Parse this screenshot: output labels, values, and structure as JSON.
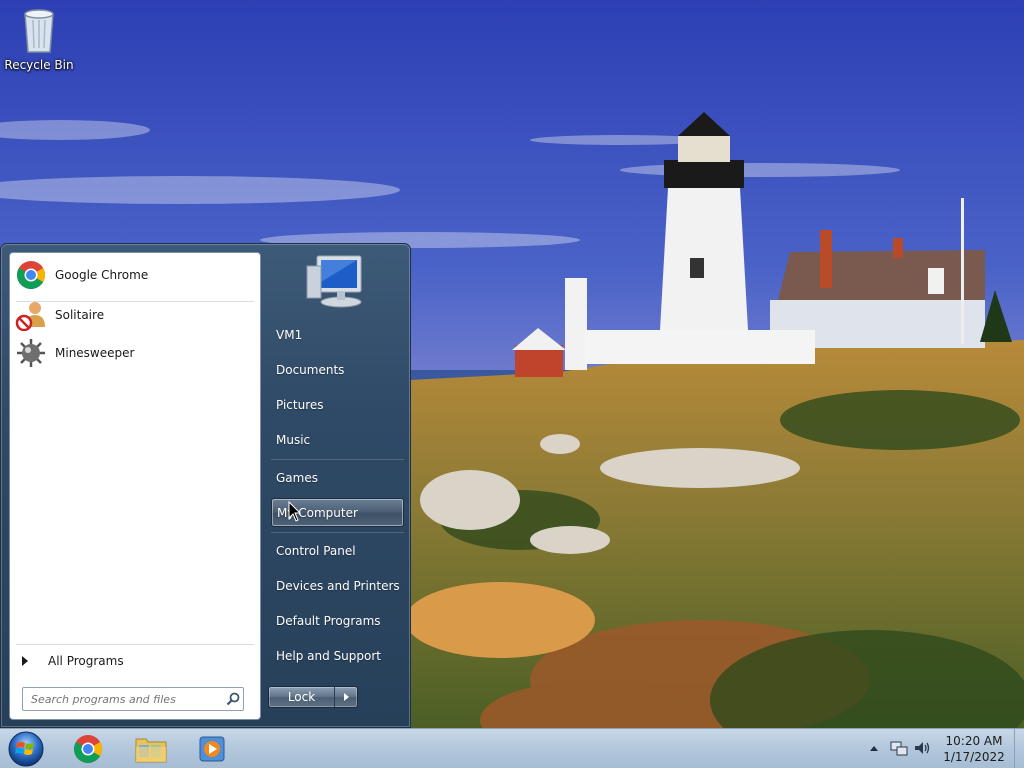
{
  "desktop": {
    "icons": [
      {
        "label": "Recycle Bin",
        "icon": "recycle-bin-icon"
      }
    ]
  },
  "start_menu": {
    "pinned_programs": [
      {
        "label": "Google Chrome",
        "icon": "chrome-icon"
      },
      {
        "label": "Solitaire",
        "icon": "solitaire-icon"
      },
      {
        "label": "Minesweeper",
        "icon": "minesweeper-icon"
      }
    ],
    "all_programs_label": "All Programs",
    "search_placeholder": "Search programs and files",
    "right_items": [
      {
        "label": "VM1"
      },
      {
        "label": "Documents"
      },
      {
        "label": "Pictures"
      },
      {
        "label": "Music"
      },
      {
        "label": "Games"
      },
      {
        "label": "My Computer",
        "highlighted": true
      },
      {
        "label": "Control Panel"
      },
      {
        "label": "Devices and Printers"
      },
      {
        "label": "Default Programs"
      },
      {
        "label": "Help and Support"
      }
    ],
    "lock_label": "Lock"
  },
  "taskbar": {
    "pinned": [
      {
        "icon": "chrome-icon"
      },
      {
        "icon": "file-explorer-icon"
      },
      {
        "icon": "media-player-icon"
      }
    ],
    "clock": {
      "time": "10:20 AM",
      "date": "1/17/2022"
    }
  },
  "colors": {
    "menu_blue": "#2f4a66",
    "taskbar": "#b2c7dc",
    "highlight": "#4d6076"
  }
}
